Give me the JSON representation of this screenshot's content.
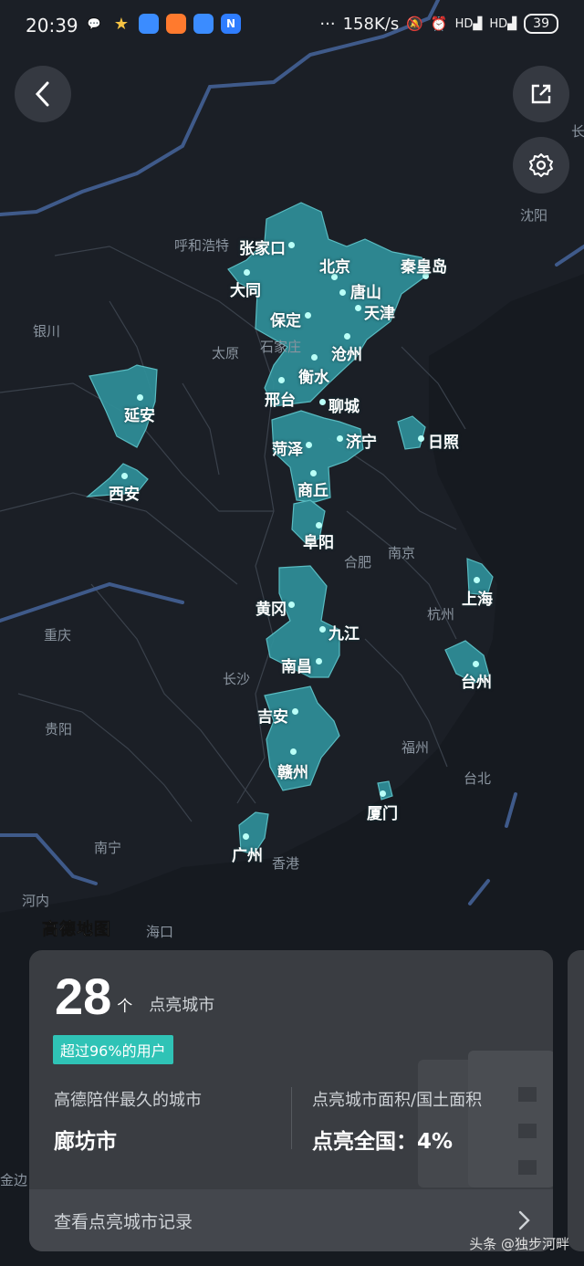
{
  "status_bar": {
    "time": "20:39",
    "speed": "158K/s",
    "battery": "39"
  },
  "nav": {
    "back_icon": "chevron-left-icon",
    "share_icon": "share-icon",
    "settings_icon": "gear-icon"
  },
  "map": {
    "lit_cities": [
      {
        "key": "zhangjiakou",
        "name": "张家口"
      },
      {
        "key": "beijing",
        "name": "北京"
      },
      {
        "key": "qinhuangdao",
        "name": "秦皇岛"
      },
      {
        "key": "datong",
        "name": "大同"
      },
      {
        "key": "tangshan",
        "name": "唐山"
      },
      {
        "key": "tianjin",
        "name": "天津"
      },
      {
        "key": "baoding",
        "name": "保定"
      },
      {
        "key": "cangzhou",
        "name": "沧州"
      },
      {
        "key": "hengshui",
        "name": "衡水"
      },
      {
        "key": "xingtai",
        "name": "邢台"
      },
      {
        "key": "liaocheng",
        "name": "聊城"
      },
      {
        "key": "yanan",
        "name": "延安"
      },
      {
        "key": "heze",
        "name": "菏泽"
      },
      {
        "key": "jining",
        "name": "济宁"
      },
      {
        "key": "rizhao",
        "name": "日照"
      },
      {
        "key": "xian",
        "name": "西安"
      },
      {
        "key": "shangqiu",
        "name": "商丘"
      },
      {
        "key": "fuyang",
        "name": "阜阳"
      },
      {
        "key": "shanghai",
        "name": "上海"
      },
      {
        "key": "huanggang",
        "name": "黄冈"
      },
      {
        "key": "jiujiang",
        "name": "九江"
      },
      {
        "key": "nanchang",
        "name": "南昌"
      },
      {
        "key": "taizhou",
        "name": "台州"
      },
      {
        "key": "jian",
        "name": "吉安"
      },
      {
        "key": "ganzhou",
        "name": "赣州"
      },
      {
        "key": "xiamen",
        "name": "厦门"
      },
      {
        "key": "guangzhou",
        "name": "广州"
      }
    ],
    "base_labels": [
      {
        "key": "hohhot",
        "name": "呼和浩特"
      },
      {
        "key": "shenyang",
        "name": "沈阳"
      },
      {
        "key": "changchun",
        "name": "长"
      },
      {
        "key": "yinchuan",
        "name": "银川"
      },
      {
        "key": "taiyuan",
        "name": "太原"
      },
      {
        "key": "shijiazhuang",
        "name": "石家庄"
      },
      {
        "key": "hefei",
        "name": "合肥"
      },
      {
        "key": "nanjing",
        "name": "南京"
      },
      {
        "key": "hangzhou",
        "name": "杭州"
      },
      {
        "key": "chongqing",
        "name": "重庆"
      },
      {
        "key": "changsha",
        "name": "长沙"
      },
      {
        "key": "guiyang",
        "name": "贵阳"
      },
      {
        "key": "fuzhou",
        "name": "福州"
      },
      {
        "key": "taibei",
        "name": "台北"
      },
      {
        "key": "nanning",
        "name": "南宁"
      },
      {
        "key": "hongkong",
        "name": "香港"
      },
      {
        "key": "hanoi",
        "name": "河内"
      },
      {
        "key": "haikou",
        "name": "海口"
      },
      {
        "key": "jinbian",
        "name": "金边"
      }
    ],
    "logo": "高德地图",
    "colors": {
      "background": "#1b1f26",
      "land": "#262b33",
      "lit_region": "#2f8f99",
      "border": "#3f5a8a",
      "sea": "#161a20"
    }
  },
  "card": {
    "count": "28",
    "count_unit": "个",
    "count_label": "点亮城市",
    "badge": "超过96%的用户",
    "stat_left_title": "高德陪伴最久的城市",
    "stat_left_value": "廊坊市",
    "stat_right_title": "点亮城市面积/国土面积",
    "stat_right_value": "点亮全国：4%",
    "record_label": "查看点亮城市记录",
    "accent": "#2fc3b6"
  },
  "watermark": "头条 @独步河畔"
}
